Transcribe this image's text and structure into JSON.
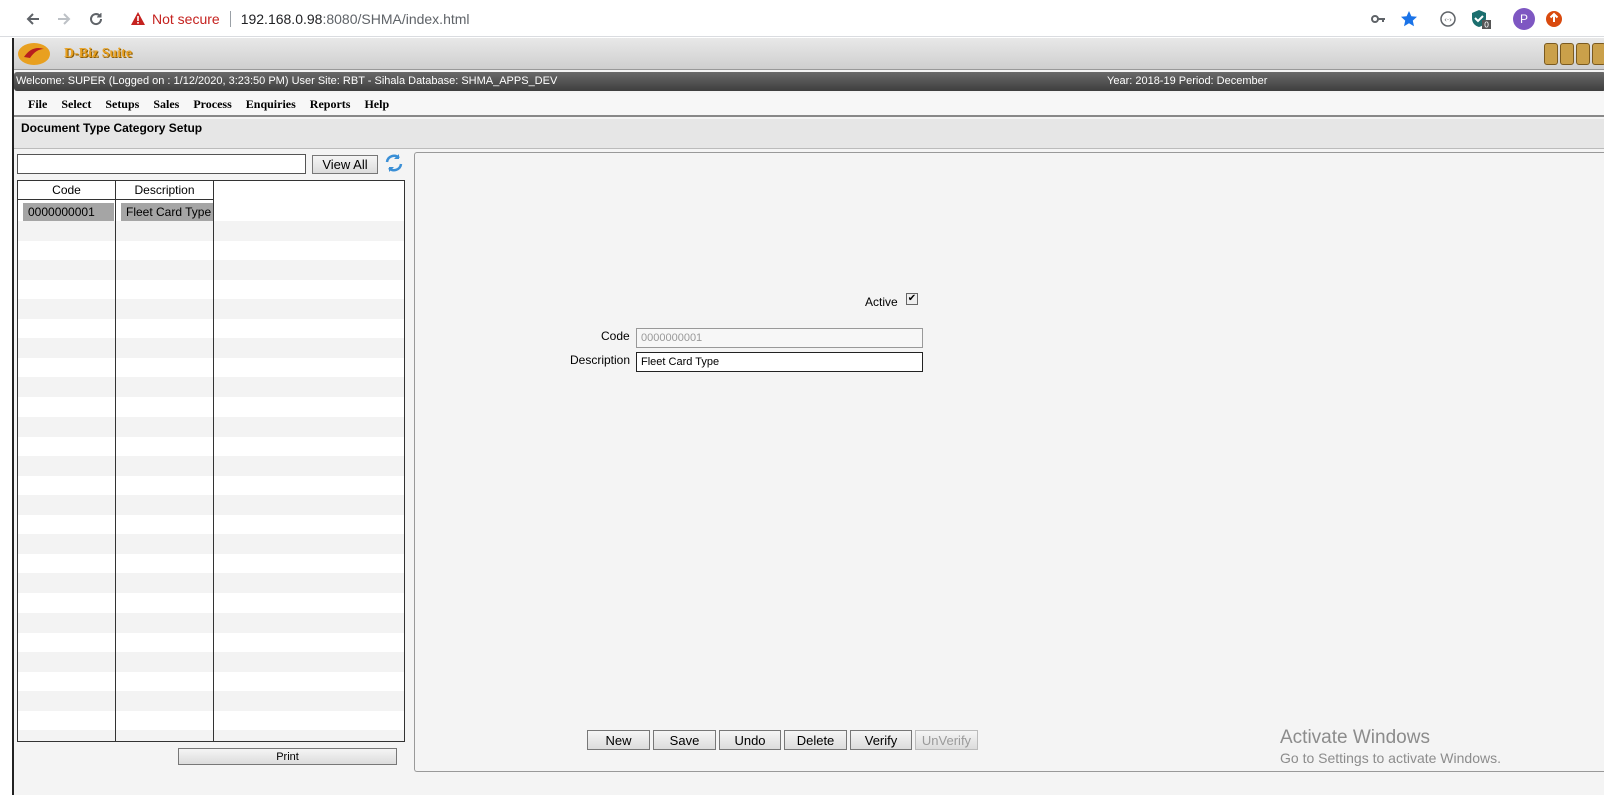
{
  "browser": {
    "security_label": "Not secure",
    "url_host": "192.168.0.98",
    "url_path": ":8080/SHMA/index.html",
    "profile_initial": "P",
    "extension_badge": "0"
  },
  "app": {
    "suite_name": "D-Biz Suite",
    "welcome_text": "Welcome: SUPER (Logged on : 1/12/2020, 3:23:50 PM) User Site: RBT - Sihala Database: SHMA_APPS_DEV",
    "period_text": "Year: 2018-19 Period: December",
    "menu": [
      "File",
      "Select",
      "Setups",
      "Sales",
      "Process",
      "Enquiries",
      "Reports",
      "Help"
    ],
    "page_title": "Document Type Category Setup"
  },
  "list": {
    "search_value": "",
    "view_all_label": "View All",
    "columns": [
      "Code",
      "Description"
    ],
    "rows": [
      {
        "code": "0000000001",
        "description": "Fleet Card Type"
      }
    ],
    "print_label": "Print"
  },
  "form": {
    "active_label": "Active",
    "active_checked": true,
    "code_label": "Code",
    "code_value": "0000000001",
    "description_label": "Description",
    "description_value": "Fleet Card Type"
  },
  "actions": {
    "new": "New",
    "save": "Save",
    "undo": "Undo",
    "delete": "Delete",
    "verify": "Verify",
    "unverify": "UnVerify"
  },
  "watermark": {
    "line1": "Activate Windows",
    "line2": "Go to Settings to activate Windows."
  },
  "colors": {
    "brand_orange": "#e8a020",
    "selected_cell": "#a5a5a5",
    "warning_red": "#c5221f"
  }
}
